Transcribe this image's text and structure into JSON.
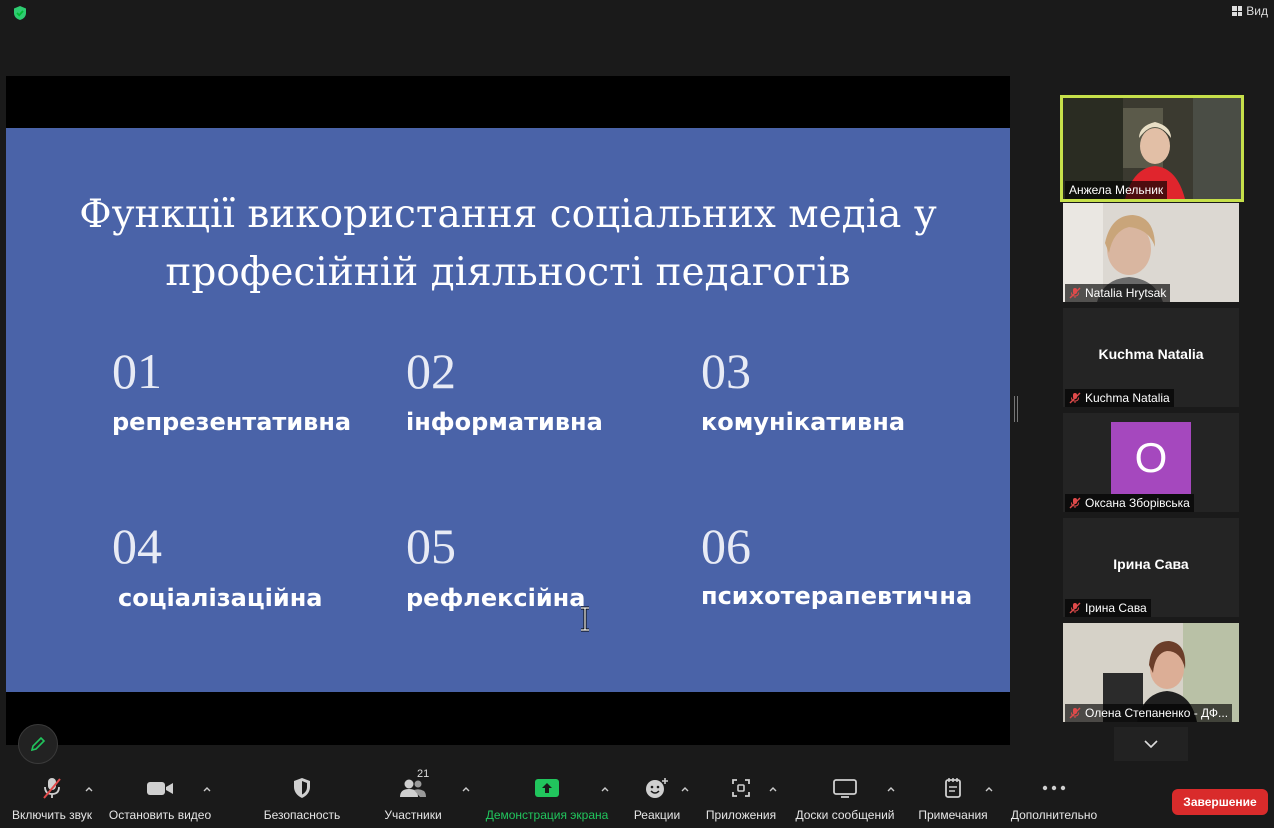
{
  "top_bar": {
    "view_label": "Вид",
    "shield_color": "#2ecc71"
  },
  "slide": {
    "title_line1": "Функції використання соціальних медіа у",
    "title_line2": "професійній діяльності педагогів",
    "background": "#4a63a8",
    "functions": [
      {
        "num": "01",
        "label": "репрезентативна"
      },
      {
        "num": "02",
        "label": "інформативна"
      },
      {
        "num": "03",
        "label": "комунікативна"
      },
      {
        "num": "04",
        "label": "соціалізаційна"
      },
      {
        "num": "05",
        "label": "рефлексійна"
      },
      {
        "num": "06",
        "label": "психотерапевтична"
      }
    ]
  },
  "participants": [
    {
      "name": "Анжела Мельник",
      "active_speaker": true,
      "muted": false
    },
    {
      "name": "Natalia Hrytsak",
      "muted": true
    },
    {
      "name": "Kuchma Natalia",
      "center_name": "Kuchma Natalia",
      "muted": true
    },
    {
      "name": "Оксана Зборівська",
      "avatar_letter": "О",
      "avatar_color": "#a548be",
      "muted": true
    },
    {
      "name": "Ірина Сава",
      "center_name": "Ірина Сава",
      "muted": true
    },
    {
      "name": "Олена Степаненко - ДФ...",
      "muted": true
    }
  ],
  "toolbar": {
    "mute_label": "Включить звук",
    "video_label": "Остановить видео",
    "security_label": "Безопасность",
    "participants_label": "Участники",
    "participants_count": "21",
    "share_label": "Демонстрация экрана",
    "reactions_label": "Реакции",
    "apps_label": "Приложения",
    "whiteboard_label": "Доски сообщений",
    "notes_label": "Примечания",
    "more_label": "Дополнительно",
    "end_label": "Завершение"
  },
  "colors": {
    "active_speaker_border": "#c6e04a",
    "share_green": "#21c55d",
    "end_red": "#d92b2b",
    "muted_red": "#e04a4a"
  }
}
